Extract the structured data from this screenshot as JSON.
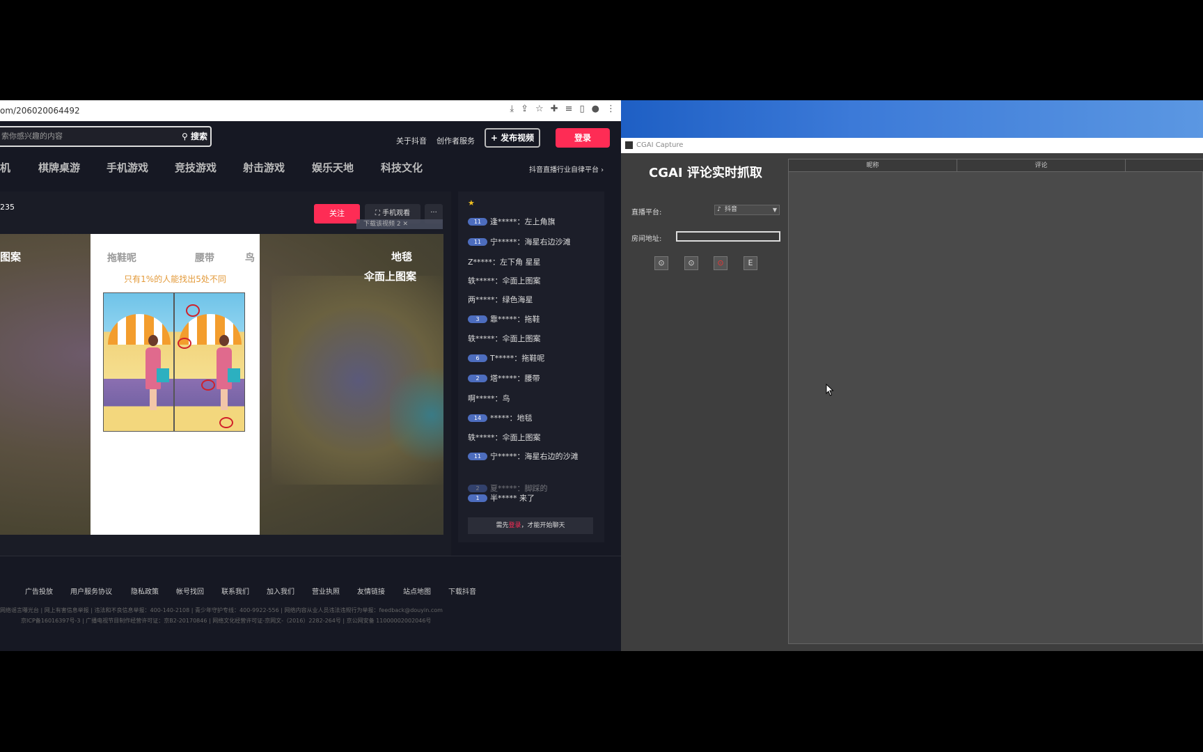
{
  "browser": {
    "url": "om/206020064492",
    "search_placeholder": "索你感兴趣的内容",
    "search_button": "搜索",
    "nav": {
      "about": "关于抖音",
      "creator": "创作者服务",
      "publish": "+ 发布视频",
      "login": "登录"
    },
    "categories": [
      "机",
      "棋牌桌游",
      "手机游戏",
      "竞技游戏",
      "射击游戏",
      "娱乐天地",
      "科技文化"
    ],
    "category_right": "抖音直播行业自律平台 ›",
    "viewer_count": "235",
    "follow": "关注",
    "mobile_watch": "手机观看",
    "more": "···",
    "download_bar": "下载该视频  2 ✕",
    "video_text": {
      "left": "图案",
      "right1": "地毯",
      "right2": "伞面上图案"
    },
    "card": {
      "h1": "拖鞋呢",
      "h2": "腰带",
      "h3": "鸟",
      "subtitle": "只有1%的人能找出5处不同"
    }
  },
  "chat": {
    "top_partial": "★",
    "messages": [
      {
        "level": "11",
        "user": "逢*****",
        "text": "左上角旗"
      },
      {
        "level": "11",
        "user": "宁*****",
        "text": "海星右边沙滩"
      },
      {
        "level": "",
        "user": "Z*****",
        "text": "左下角 星星"
      },
      {
        "level": "",
        "user": "轶*****",
        "text": "伞面上图案"
      },
      {
        "level": "",
        "user": "两*****",
        "text": "绿色海星"
      },
      {
        "level": "3",
        "user": "靠*****",
        "text": "拖鞋"
      },
      {
        "level": "",
        "user": "轶*****",
        "text": "伞面上图案"
      },
      {
        "level": "6",
        "user": "T*****",
        "text": "拖鞋呢"
      },
      {
        "level": "2",
        "user": "塔*****",
        "text": "腰带"
      },
      {
        "level": "",
        "user": "啊*****",
        "text": "鸟"
      },
      {
        "level": "14",
        "user": "*****",
        "text": "地毯"
      },
      {
        "level": "",
        "user": "轶*****",
        "text": "伞面上图案"
      },
      {
        "level": "11",
        "user": "宁*****",
        "text": "海星右边的沙滩"
      },
      {
        "level": "2",
        "user": "夏*****",
        "text": "脚踩的"
      },
      {
        "level": "1",
        "user": "半*****",
        "text": "来了"
      }
    ],
    "login_prefix": "需先",
    "login_link": "登录",
    "login_suffix": "，才能开始聊天"
  },
  "footer": {
    "links": [
      "广告投放",
      "用户服务协议",
      "隐私政策",
      "帐号找回",
      "联系我们",
      "加入我们",
      "营业执照",
      "友情链接",
      "站点地图",
      "下载抖音"
    ],
    "line1": "网络谣言曝光台 | 网上有害信息举报 | 违法和不良信息举报：400-140-2108 | 青少年守护专线：400-9922-556 | 网络内容从业人员违法违规行为举报：feedback@douyin.com",
    "line2": "京ICP备16016397号-3 | 广播电视节目制作经营许可证：京B2-20170846 | 网络文化经营许可证-京网文-（2016）2282-264号 |  京公网安备 11000002002046号"
  },
  "app": {
    "window_title": "CGAI Capture",
    "title": "CGAI 评论实时抓取",
    "platform_label": "直播平台:",
    "platform_value": "抖音",
    "room_label": "房间地址:",
    "room_value": "",
    "buttons": [
      "⊙",
      "⊙",
      "⊙",
      "E"
    ],
    "columns": [
      "昵称",
      "评论",
      ""
    ]
  }
}
